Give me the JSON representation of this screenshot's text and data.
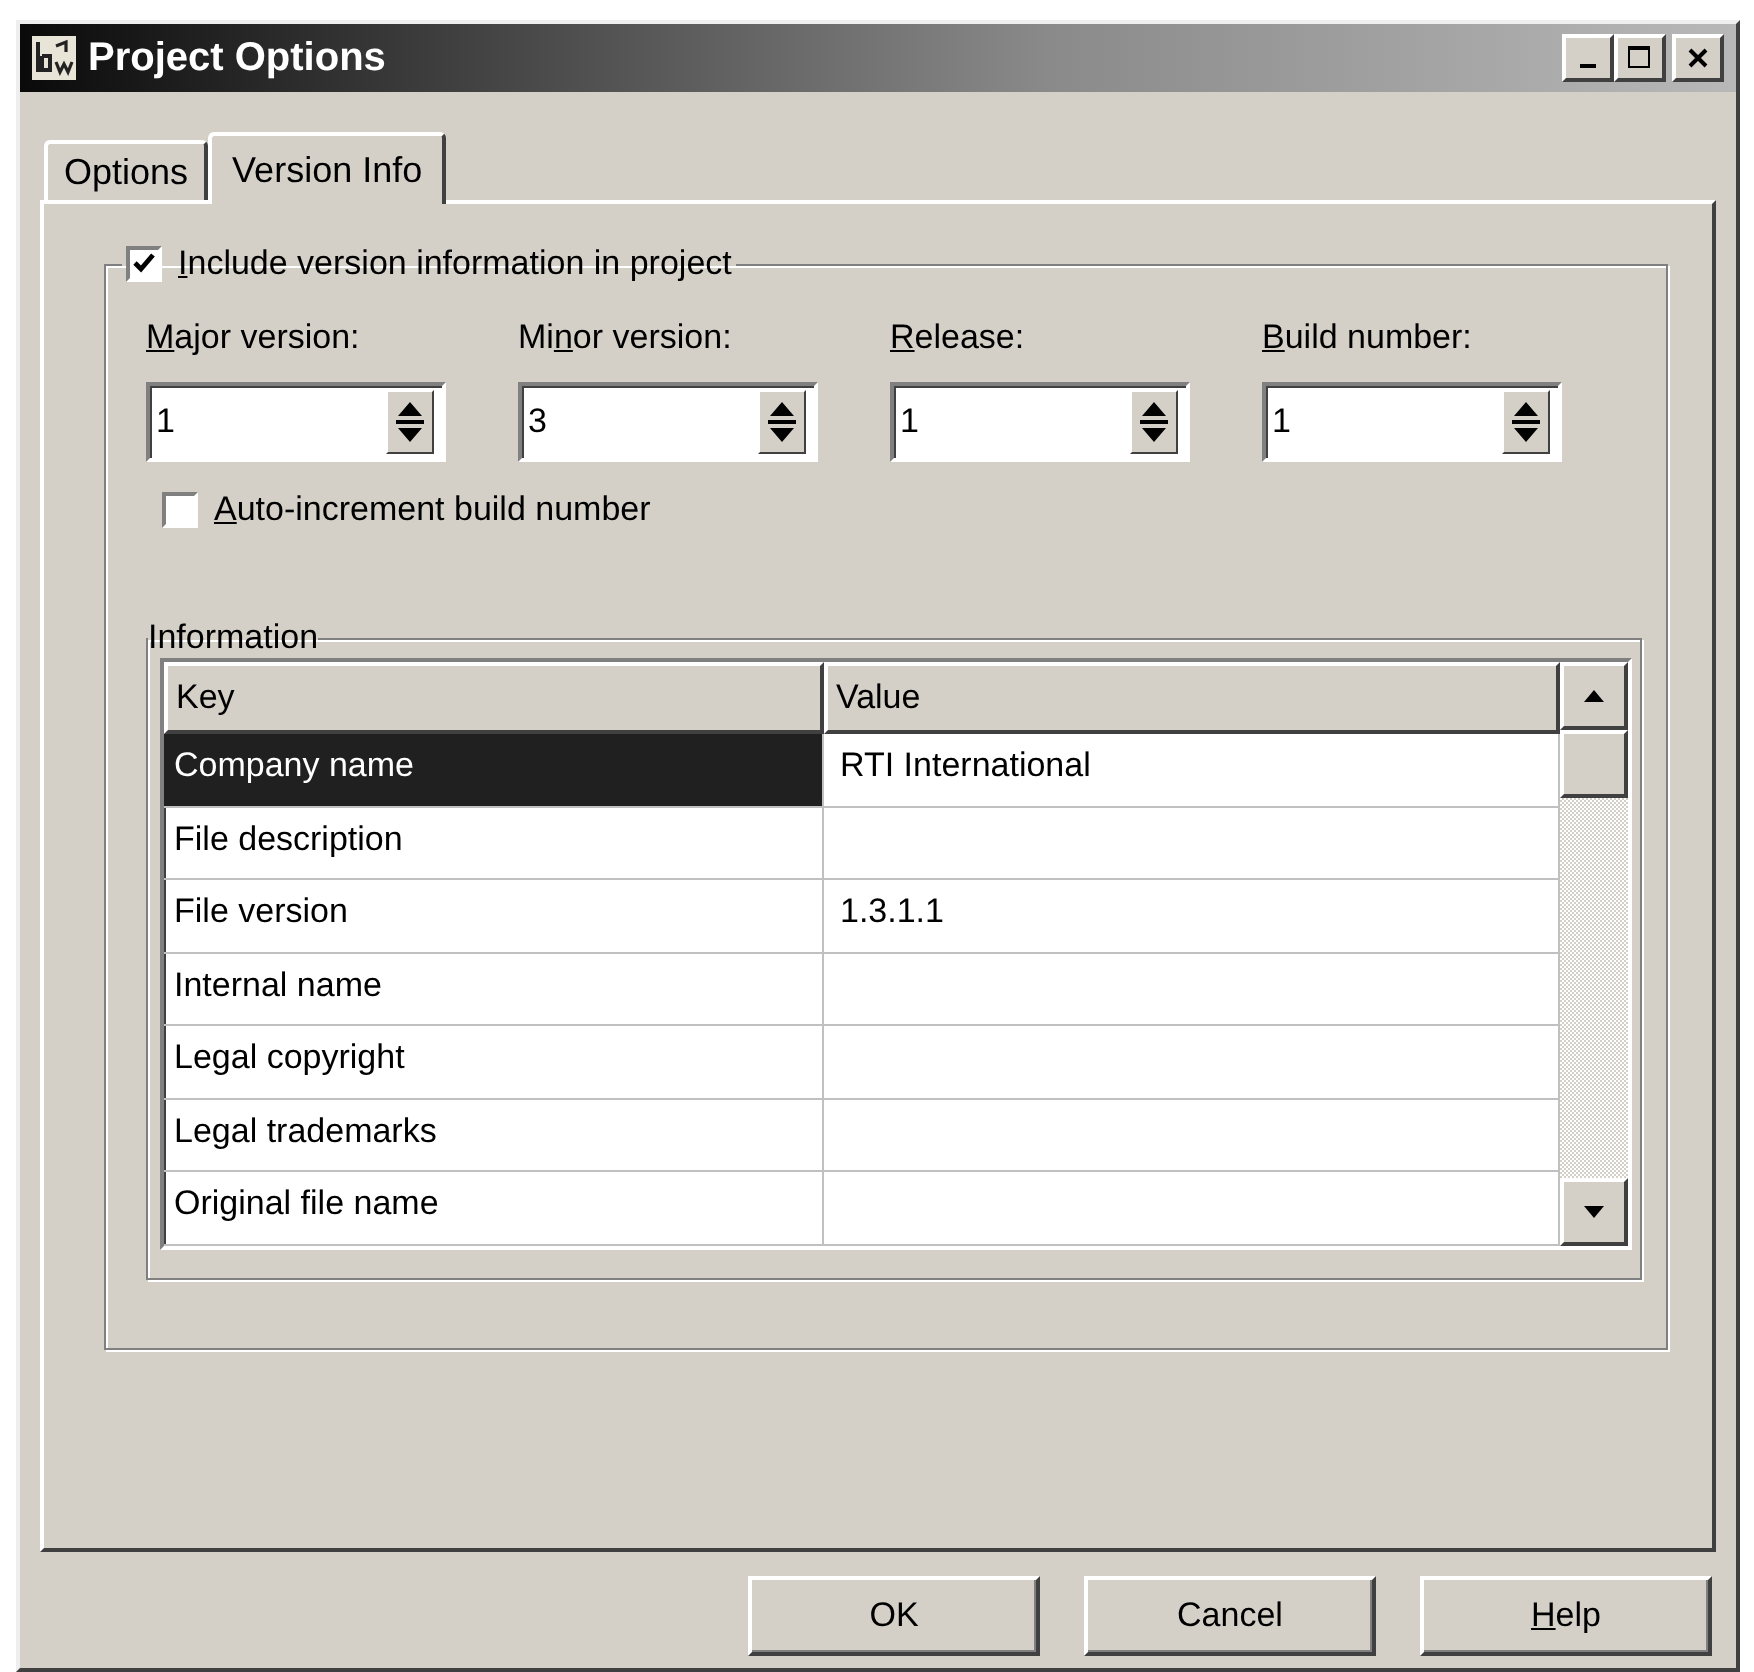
{
  "window": {
    "title": "Project Options"
  },
  "tabs": [
    {
      "label": "Options",
      "selected": false
    },
    {
      "label": "Version Info",
      "selected": true
    }
  ],
  "include_version": {
    "label": [
      {
        "text": "I",
        "underline": true
      },
      {
        "text": "nclude version information in project",
        "underline": false
      }
    ],
    "checked": true
  },
  "version_fields": [
    {
      "label": [
        {
          "text": "M",
          "underline": true
        },
        {
          "text": "ajor version:",
          "underline": false
        }
      ],
      "value": "1"
    },
    {
      "label": [
        {
          "text": "Mi",
          "underline": false
        },
        {
          "text": "n",
          "underline": true
        },
        {
          "text": "or version:",
          "underline": false
        }
      ],
      "value": "3"
    },
    {
      "label": [
        {
          "text": "R",
          "underline": true
        },
        {
          "text": "elease:",
          "underline": false
        }
      ],
      "value": "1"
    },
    {
      "label": [
        {
          "text": "B",
          "underline": true
        },
        {
          "text": "uild number:",
          "underline": false
        }
      ],
      "value": "1"
    }
  ],
  "auto_increment": {
    "label": [
      {
        "text": "A",
        "underline": true
      },
      {
        "text": "uto-increment build number",
        "underline": false
      }
    ],
    "checked": false
  },
  "information": {
    "title": "Information",
    "columns": [
      "Key",
      "Value"
    ],
    "rows": [
      {
        "key": "Company name",
        "value": "RTI International",
        "selected": true
      },
      {
        "key": "File description",
        "selected": false
      },
      {
        "key": "File version",
        "value": "1.3.1.1",
        "selected": false
      },
      {
        "key": "Internal name",
        "selected": false
      },
      {
        "key": "Legal copyright",
        "selected": false
      },
      {
        "key": "Legal trademarks",
        "selected": false
      },
      {
        "key": "Original file name",
        "selected": false
      }
    ]
  },
  "buttons": [
    {
      "label": [
        {
          "text": "OK",
          "underline": false
        }
      ]
    },
    {
      "label": [
        {
          "text": "Cancel",
          "underline": false
        }
      ]
    },
    {
      "label": [
        {
          "text": "H",
          "underline": true
        },
        {
          "text": "elp",
          "underline": false
        }
      ]
    }
  ]
}
